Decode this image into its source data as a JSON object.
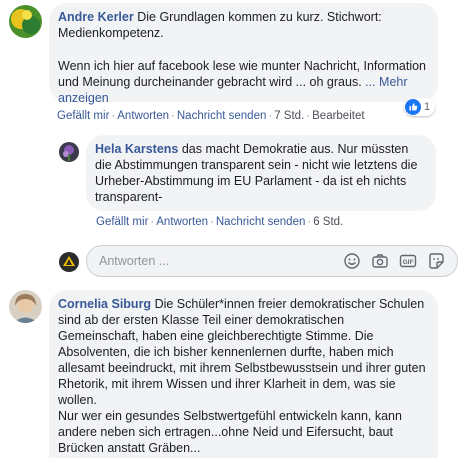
{
  "comments": [
    {
      "author": "Andre Kerler",
      "text_1": "Die Grundlagen kommen zu kurz. Stichwort: Medienkompetenz.",
      "text_2": "Wenn ich hier auf facebook lese wie munter Nachricht, Information und Meinung durcheinander gebracht wird ... oh graus.",
      "more": "... Mehr anzeigen",
      "actions": {
        "like": "Gefällt mir",
        "reply": "Antworten",
        "message": "Nachricht senden",
        "time": "7 Std.",
        "edited": "Bearbeitet"
      },
      "reaction_count": "1"
    },
    {
      "author": "Hela Karstens",
      "text": "das macht Demokratie aus. Nur müssten die Abstimmungen transparent sein - nicht wie letztens die Urheber-Abstimmung im EU Parlament - da ist eh nichts transparent-",
      "actions": {
        "like": "Gefällt mir",
        "reply": "Antworten",
        "message": "Nachricht senden",
        "time": "6 Std."
      }
    },
    {
      "author": "Cornelia Siburg",
      "text_1": "Die Schüler*innen freier demokratischer Schulen sind ab der ersten Klasse Teil einer demokratischen Gemeinschaft, haben eine gleichberechtigte Stimme. Die Absolventen, die ich bisher kennenlernen durfte, haben mich allesamt beeindruckt, mit ihrem Selbstbewusstsein und ihrer guten Rhetorik, mit ihrem Wissen und ihrer Klarheit in dem, was sie wollen.",
      "text_2": "Nur wer ein gesundes Selbstwertgefühl entwickeln kann, kann andere neben sich ertragen...ohne Neid und Eifersucht, baut Brücken anstatt Gräben..."
    }
  ],
  "reply_box": {
    "placeholder": "Antworten ..."
  },
  "colors": {
    "link": "#385898",
    "bubble": "#f2f3f5",
    "like_blue": "#1877f2"
  }
}
